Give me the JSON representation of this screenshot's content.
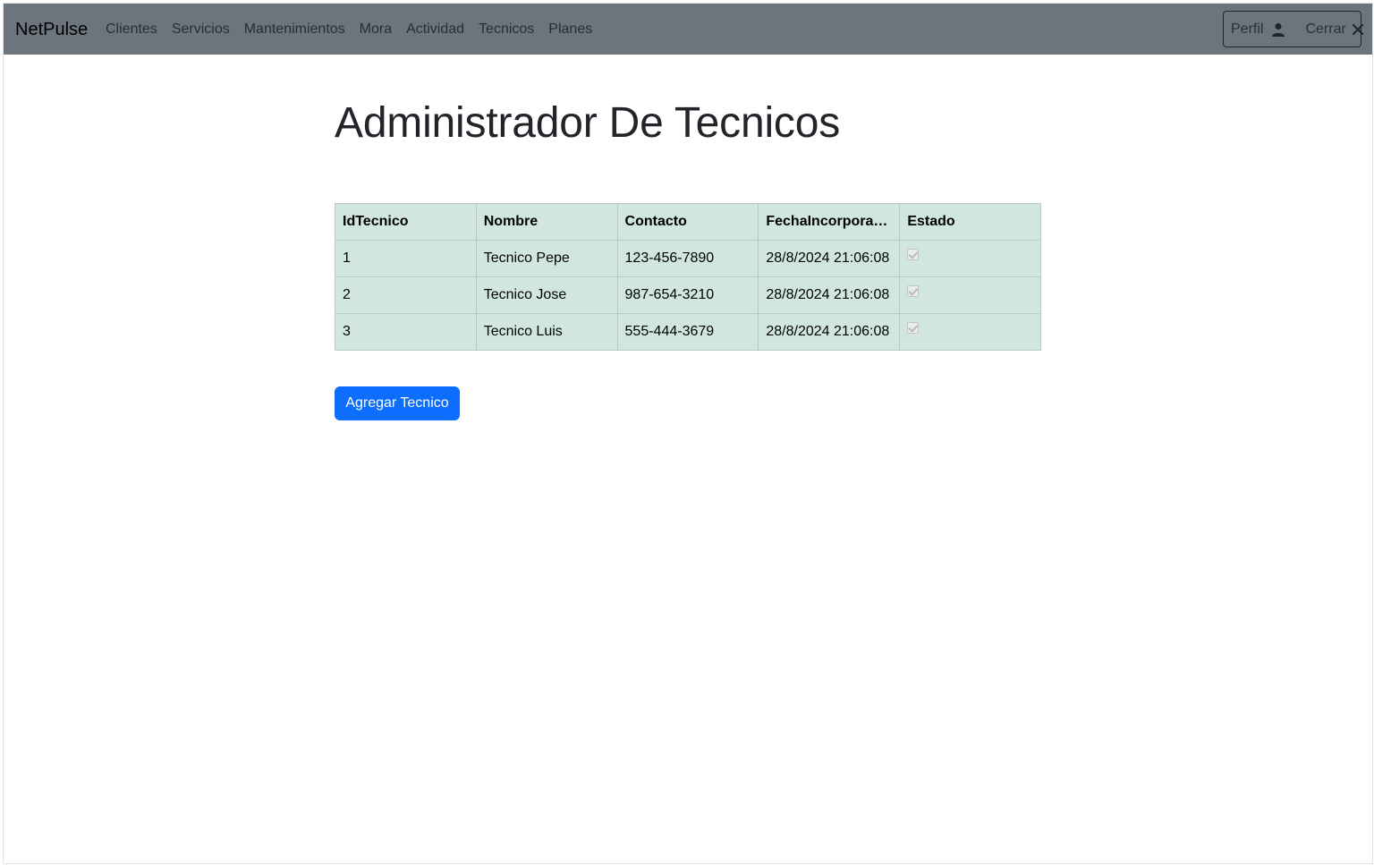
{
  "navbar": {
    "brand": "NetPulse",
    "links": [
      "Clientes",
      "Servicios",
      "Mantenimientos",
      "Mora",
      "Actividad",
      "Tecnicos",
      "Planes"
    ],
    "profile_label": "Perfil",
    "logout_label": "Cerrar"
  },
  "page": {
    "title": "Administrador De Tecnicos",
    "add_button": "Agregar Tecnico"
  },
  "table": {
    "headers": [
      "IdTecnico",
      "Nombre",
      "Contacto",
      "FechaIncorporac...",
      "Estado"
    ],
    "rows": [
      {
        "id": "1",
        "nombre": "Tecnico Pepe",
        "contacto": "123-456-7890",
        "fecha": "28/8/2024 21:06:08",
        "estado": true
      },
      {
        "id": "2",
        "nombre": "Tecnico Jose",
        "contacto": "987-654-3210",
        "fecha": "28/8/2024 21:06:08",
        "estado": true
      },
      {
        "id": "3",
        "nombre": "Tecnico Luis",
        "contacto": "555-444-3679",
        "fecha": "28/8/2024 21:06:08",
        "estado": true
      }
    ]
  },
  "colors": {
    "navbar_bg": "#6c757d",
    "table_bg": "#d1e7dd",
    "primary": "#0d6efd"
  },
  "icons": {
    "profile": "user-icon",
    "logout": "close-icon"
  }
}
